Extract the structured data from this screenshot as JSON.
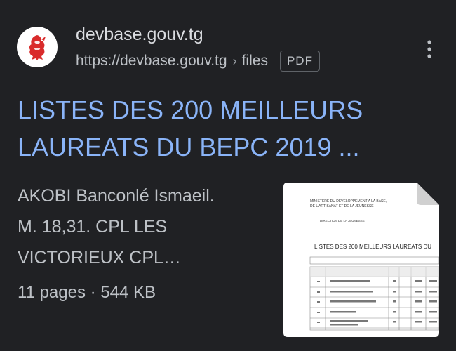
{
  "site": {
    "name": "devbase.gouv.tg",
    "url": "https://devbase.gouv.tg",
    "separator": "›",
    "path": "files",
    "file_type": "PDF",
    "favicon_icon": "togo-lion-emblem-icon"
  },
  "result": {
    "title_line1": "LISTES DES 200 MEILLEURS",
    "title_line2": "LAUREATS DU BEPC 2019 ...",
    "snippet_line1": "AKOBI Banconlé Ismaeil.",
    "snippet_line2": "M. 18,31. CPL LES",
    "snippet_line3": "VICTORIEUX CPL…",
    "pages": "11 pages",
    "meta_sep": "·",
    "size": "544 KB"
  },
  "thumbnail": {
    "icon": "pdf-page-thumbnail-icon",
    "header_lines": [
      "MINISTERE DU DEVELOPPEMENT A LA BASE,",
      "DE L'ARTISANAT ET DE LA JEUNESSE",
      "DIRECTION DE LA JEUNESSE"
    ],
    "doc_title": "LISTES DES 200 MEILLEURS LAUREATS DU"
  },
  "menu": {
    "icon": "more-vert-icon"
  },
  "colors": {
    "background": "#202124",
    "link": "#8ab4f8",
    "text": "#bdc1c6",
    "site_name": "#dadce0",
    "emblem_red": "#d92b2b"
  }
}
